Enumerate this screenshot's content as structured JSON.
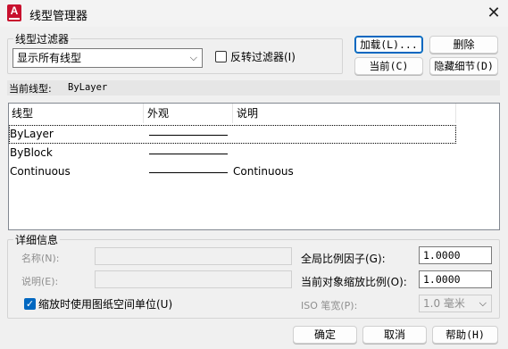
{
  "window": {
    "title": "线型管理器",
    "app_icon_letter": "A"
  },
  "filter": {
    "group_label": "线型过滤器",
    "selected": "显示所有线型",
    "invert_label": "反转过滤器(I)",
    "invert_checked": false
  },
  "buttons": {
    "load": "加载(L)...",
    "delete": "删除",
    "current": "当前(C)",
    "hide_details": "隐藏细节(D)",
    "ok": "确定",
    "cancel": "取消",
    "help": "帮助(H)"
  },
  "current_linetype": {
    "label": "当前线型:",
    "value": "ByLayer"
  },
  "table": {
    "columns": [
      "线型",
      "外观",
      "说明"
    ],
    "rows": [
      {
        "name": "ByLayer",
        "description": "",
        "selected": true
      },
      {
        "name": "ByBlock",
        "description": "",
        "selected": false
      },
      {
        "name": "Continuous",
        "description": "Continuous",
        "selected": false
      }
    ]
  },
  "details": {
    "group_label": "详细信息",
    "name_label": "名称(N):",
    "description_label": "说明(E):",
    "paper_space_label": "缩放时使用图纸空间单位(U)",
    "paper_space_checked": true,
    "global_scale_label": "全局比例因子(G):",
    "global_scale_value": "1.0000",
    "current_scale_label": "当前对象缩放比例(O):",
    "current_scale_value": "1.0000",
    "iso_pen_label": "ISO 笔宽(P):",
    "iso_pen_value": "1.0 毫米"
  }
}
